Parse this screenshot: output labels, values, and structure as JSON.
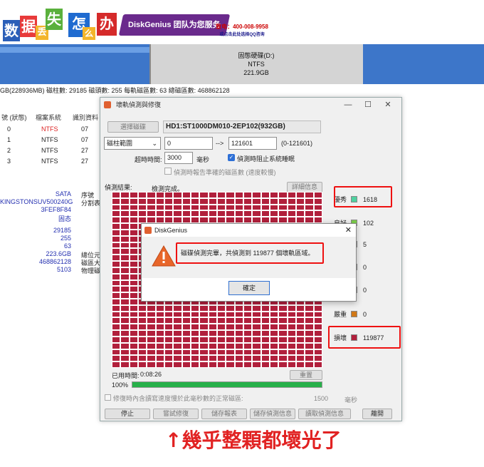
{
  "banner": {
    "chars": [
      "数",
      "据",
      "丢",
      "失",
      "怎",
      "么",
      "办"
    ],
    "slogan": "DiskGenius 团队为您服务",
    "phone": "致电：400-008-9958",
    "qq": "或点击此处选择QQ咨询"
  },
  "partition": {
    "name": "固態硬碟(D:)",
    "fs": "NTFS",
    "size": "221.9GB"
  },
  "geometry_line": "GB(228936MB) 磁柱數: 29185 磁頭數: 255 每軌磁區數: 63 總磁區數: 468862128",
  "left_table": {
    "headers": [
      "號 (狀態)",
      "檔案系統",
      "識別資料"
    ],
    "rows": [
      [
        "0",
        "NTFS",
        "07"
      ],
      [
        "1",
        "NTFS",
        "07"
      ],
      [
        "2",
        "NTFS",
        "27"
      ],
      [
        "3",
        "NTFS",
        "27"
      ]
    ]
  },
  "left_info": {
    "values1": [
      "SATA",
      "KINGSTONSUV500240G",
      "3FEF8F84",
      "固态"
    ],
    "labels1": [
      "序號",
      "分割表"
    ],
    "values2": [
      "29185",
      "255",
      "63",
      "223.6GB",
      "468862128",
      "5103"
    ],
    "labels2": [
      "總位元",
      "磁區大",
      "物理磁"
    ]
  },
  "dialog": {
    "title": "壞軌偵測與修復",
    "select_disk_btn": "選擇磁碟",
    "disk_name": "HD1:ST1000DM010-2EP102(932GB)",
    "range_select": "磁柱範圍",
    "range_from": "0",
    "range_to": "121601",
    "range_note": "(0-121601)",
    "timeout_label": "超時時間:",
    "timeout_value": "3000",
    "timeout_unit": "毫秒",
    "stop_on_bad_label": "偵測時阻止系統睡眠",
    "report_slow_label": "偵測時報告準確的磁區數 (速度較慢)",
    "result_label": "偵測結果:",
    "status_text": "檢測完成。",
    "detail_btn": "詳細信息",
    "elapsed_label": "已用時間:",
    "elapsed_value": "0:08:26",
    "reset_btn": "重置",
    "progress_pct": "100%",
    "progress_value": 1.0,
    "repair_note": "修復時內含讀寫速度慢於此毫秒數的正常磁區:",
    "repair_ms": "1500",
    "repair_unit": "毫秒",
    "buttons": [
      "停止",
      "嘗試修復",
      "儲存報表",
      "儲存偵測信息",
      "讀取偵測信息",
      "離開"
    ]
  },
  "legend": [
    {
      "label": "優秀",
      "count": "1618",
      "color": "#4fd1a0"
    },
    {
      "label": "良好",
      "count": "102",
      "color": "#7ccf4a"
    },
    {
      "label": "",
      "count": "5",
      "color": "#d0d040"
    },
    {
      "label": "",
      "count": "0",
      "color": "#d8b030"
    },
    {
      "label": "",
      "count": "0",
      "color": "#d89a20"
    },
    {
      "label": "嚴重",
      "count": "0",
      "color": "#d07818"
    },
    {
      "label": "損壞",
      "count": "119877",
      "color": "#b1203c"
    }
  ],
  "msgbox": {
    "title": "DiskGenius",
    "message": "磁碟偵測完畢，共偵測到 119877 個壞軌區域。",
    "ok": "確定"
  },
  "caption": "↑幾乎整顆都壞光了"
}
